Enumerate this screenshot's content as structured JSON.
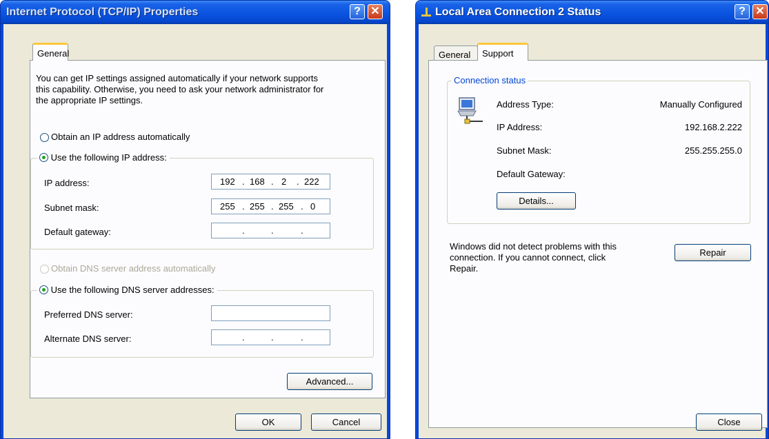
{
  "tcpip_dialog": {
    "title": "Internet Protocol (TCP/IP) Properties",
    "help_button": "?",
    "close_button": "✕",
    "tab_general": "General",
    "intro_line1": "You can get IP settings assigned automatically if your network supports",
    "intro_line2": "this capability. Otherwise, you need to ask your network administrator for",
    "intro_line3": "the appropriate IP settings.",
    "obtain_ip_auto": "Obtain an IP address automatically",
    "use_following_ip": "Use the following IP address:",
    "ip_label": "IP address:",
    "ip_octets": [
      "192",
      "168",
      "2",
      "222"
    ],
    "subnet_label": "Subnet mask:",
    "subnet_octets": [
      "255",
      "255",
      "255",
      "0"
    ],
    "gateway_label": "Default gateway:",
    "obtain_dns_auto": "Obtain DNS server address automatically",
    "use_following_dns": "Use the following DNS server addresses:",
    "preferred_dns_label": "Preferred DNS server:",
    "alternate_dns_label": "Alternate DNS server:",
    "advanced_button": "Advanced...",
    "ok_button": "OK",
    "cancel_button": "Cancel"
  },
  "status_dialog": {
    "title": "Local Area Connection 2 Status",
    "help_button": "?",
    "close_button": "✕",
    "tab_general": "General",
    "tab_support": "Support",
    "group_title": "Connection status",
    "address_type_label": "Address Type:",
    "address_type_value": "Manually Configured",
    "ip_label": "IP Address:",
    "ip_value": "192.168.2.222",
    "subnet_label": "Subnet Mask:",
    "subnet_value": "255.255.255.0",
    "gateway_label": "Default Gateway:",
    "details_button": "Details...",
    "message_line1": "Windows did not detect problems with this",
    "message_line2": "connection. If you cannot connect, click",
    "message_line3": "Repair.",
    "repair_button": "Repair",
    "close_bottom_button": "Close"
  },
  "colors": {
    "titlebar_blue": "#0a54e0",
    "dialog_face": "#ece9d8",
    "tab_highlight": "#ffc83c"
  }
}
